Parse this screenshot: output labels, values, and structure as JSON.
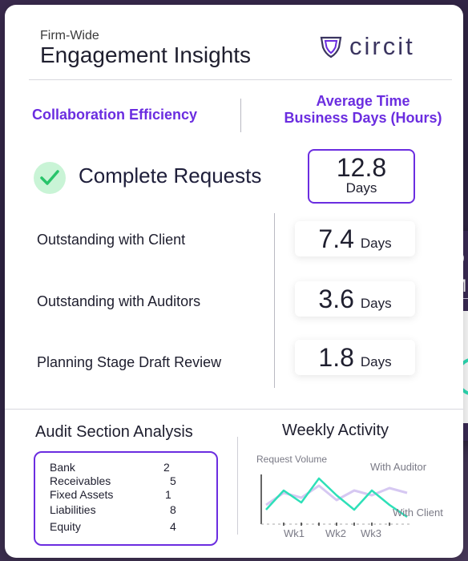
{
  "header": {
    "pre_title": "Firm-Wide",
    "title": "Engagement Insights",
    "logo_text": "circit"
  },
  "columns": {
    "left": "Collaboration Efficiency",
    "right_line1": "Average Time",
    "right_line2": "Business Days (Hours)"
  },
  "complete": {
    "label": "Complete Requests",
    "value": "12.8",
    "unit": "Days"
  },
  "rows": [
    {
      "label": "Outstanding with Client",
      "value": "7.4",
      "unit": "Days"
    },
    {
      "label": "Outstanding with Auditors",
      "value": "3.6",
      "unit": "Days"
    },
    {
      "label": "Planning Stage Draft Review",
      "value": "1.8",
      "unit": "Days"
    }
  ],
  "audit": {
    "title": "Audit Section Analysis",
    "items": [
      {
        "name": "Bank",
        "value": "2"
      },
      {
        "name": "Receivables",
        "value": "5"
      },
      {
        "name": "Fixed Assets",
        "value": "1"
      },
      {
        "name": "Liabilities",
        "value": "8"
      },
      {
        "name": "Equity",
        "value": "4"
      }
    ]
  },
  "weekly": {
    "title": "Weekly Activity"
  },
  "side_card": {
    "line1": "D",
    "line2": "M"
  },
  "colors": {
    "accent": "#6b2de0",
    "client_line": "#2ee0b8",
    "auditor_line": "#d6c8f2",
    "check_bg": "#c9f4d6",
    "check_mark": "#28c46a"
  },
  "chart_data": {
    "type": "line",
    "title": "",
    "ylabel": "Request Volume",
    "categories": [
      "Wk1",
      "Wk2",
      "Wk3"
    ],
    "x_points": [
      0,
      0.5,
      1,
      1.5,
      2,
      2.5,
      3,
      3.5,
      4
    ],
    "series": [
      {
        "name": "With Auditor",
        "values": [
          3,
          5.5,
          4.5,
          7,
          4,
          6,
          5,
          6.5,
          5.5
        ]
      },
      {
        "name": "With Client",
        "values": [
          2,
          6,
          3.5,
          8.5,
          5,
          2,
          6,
          3,
          0.5
        ]
      }
    ],
    "ylim": [
      0,
      10
    ],
    "legend": "inline"
  }
}
